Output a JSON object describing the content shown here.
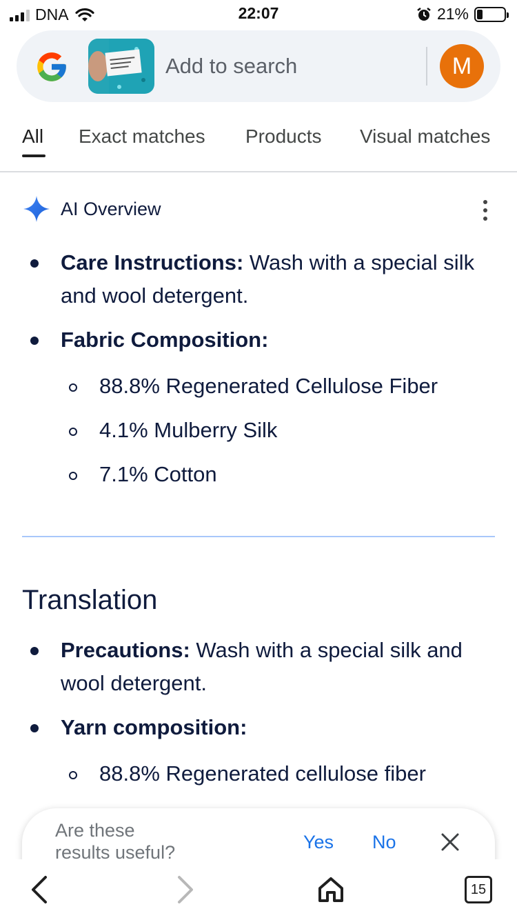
{
  "status_bar": {
    "carrier": "DNA",
    "time": "22:07",
    "battery_percent": "21%",
    "battery_level": 0.21,
    "icons": [
      "signal-icon",
      "wifi-icon",
      "alarm-icon",
      "battery-icon"
    ]
  },
  "search": {
    "placeholder": "Add to search",
    "avatar_letter": "M",
    "avatar_color": "#e8710a",
    "logo": "google-g-icon"
  },
  "tabs": [
    {
      "label": "All",
      "active": true
    },
    {
      "label": "Exact matches",
      "active": false
    },
    {
      "label": "Products",
      "active": false
    },
    {
      "label": "Visual matches",
      "active": false
    }
  ],
  "ai_overview": {
    "title": "AI Overview",
    "items": [
      {
        "label": "Care Instructions:",
        "text_line1": " Wash with a special silk",
        "text_line2": "and wool detergent."
      },
      {
        "label": "Fabric Composition:"
      }
    ],
    "sub_items": [
      "88.8% Regenerated Cellulose Fiber",
      "4.1% Mulberry Silk",
      "7.1% Cotton"
    ]
  },
  "translation": {
    "title": "Translation",
    "items": [
      {
        "label": "Precautions:",
        "text_line1": " Wash with a special silk and",
        "text_line2": "wool detergent."
      },
      {
        "label": "Yarn composition:"
      }
    ],
    "sub_items": [
      "88.8% Regenerated cellulose fiber"
    ]
  },
  "feedback": {
    "question_line1": "Are these",
    "question_line2": "results useful?",
    "yes": "Yes",
    "no": "No"
  },
  "toolbar": {
    "tabs_count": "15"
  },
  "colors": {
    "accent": "#1a73e8",
    "text": "#0f1b3d",
    "divider": "#a8c7fa"
  }
}
